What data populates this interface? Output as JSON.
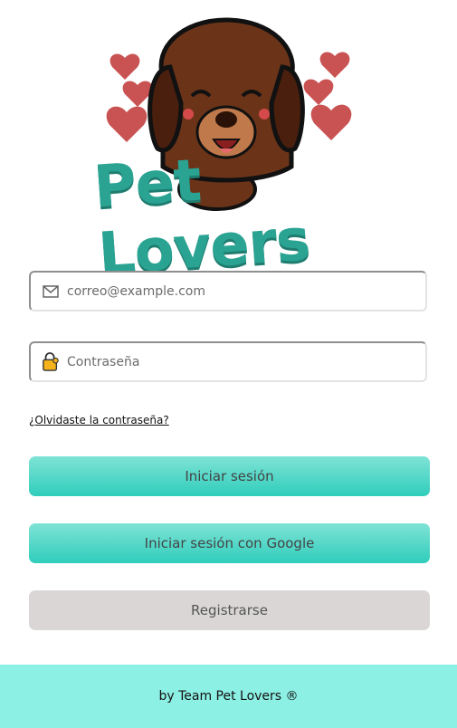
{
  "logo": {
    "text": "Pet Lovers"
  },
  "email": {
    "placeholder": "correo@example.com",
    "value": ""
  },
  "password": {
    "placeholder": "Contraseña",
    "value": ""
  },
  "forgot_password": "¿Olvidaste la contraseña?",
  "buttons": {
    "login": "Iniciar sesión",
    "google": "Iniciar sesión con Google",
    "register": "Registrarse"
  },
  "footer": {
    "text": "by Team Pet Lovers ®"
  },
  "colors": {
    "teal": "#2fcdbb",
    "footer": "#8df0e4",
    "heart": "#c95353",
    "dog": "#7a3b1e"
  },
  "icons": {
    "email": "envelope-icon",
    "password": "key-lock-icon"
  }
}
